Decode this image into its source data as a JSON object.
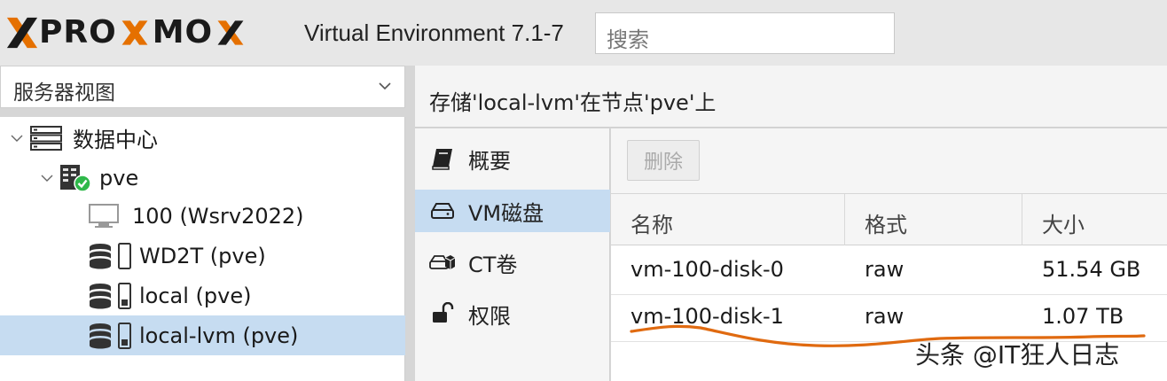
{
  "header": {
    "logo_text_a": "PRO",
    "logo_text_b": "MO",
    "version": "Virtual Environment 7.1-7",
    "search_placeholder": "搜索"
  },
  "left_panel": {
    "view_select": "服务器视图",
    "tree": [
      {
        "label": "数据中心",
        "icon": "datacenter-icon"
      },
      {
        "label": "pve",
        "icon": "node-online-icon"
      },
      {
        "label": "100 (Wsrv2022)",
        "icon": "vm-monitor-icon"
      },
      {
        "label": "WD2T (pve)",
        "icon": "storage-icon"
      },
      {
        "label": "local (pve)",
        "icon": "storage-icon"
      },
      {
        "label": "local-lvm (pve)",
        "icon": "storage-icon",
        "selected": true
      }
    ]
  },
  "right_panel": {
    "title": "存储'local-lvm'在节点'pve'上",
    "nav": [
      {
        "label": "概要",
        "icon": "book-icon"
      },
      {
        "label": "VM磁盘",
        "icon": "hdd-icon",
        "active": true
      },
      {
        "label": "CT卷",
        "icon": "container-icon"
      },
      {
        "label": "权限",
        "icon": "unlock-icon"
      }
    ],
    "toolbar": {
      "delete_label": "删除"
    },
    "table": {
      "columns": [
        "名称",
        "格式",
        "大小"
      ],
      "rows": [
        {
          "name": "vm-100-disk-0",
          "format": "raw",
          "size": "51.54 GB"
        },
        {
          "name": "vm-100-disk-1",
          "format": "raw",
          "size": "1.07 TB"
        }
      ]
    }
  },
  "watermark": "头条 @IT狂人日志",
  "colors": {
    "brand_orange": "#e57000",
    "selected_bg": "#c6dcf1",
    "annotation_line": "#e06a10",
    "status_ok": "#2fb84a"
  }
}
